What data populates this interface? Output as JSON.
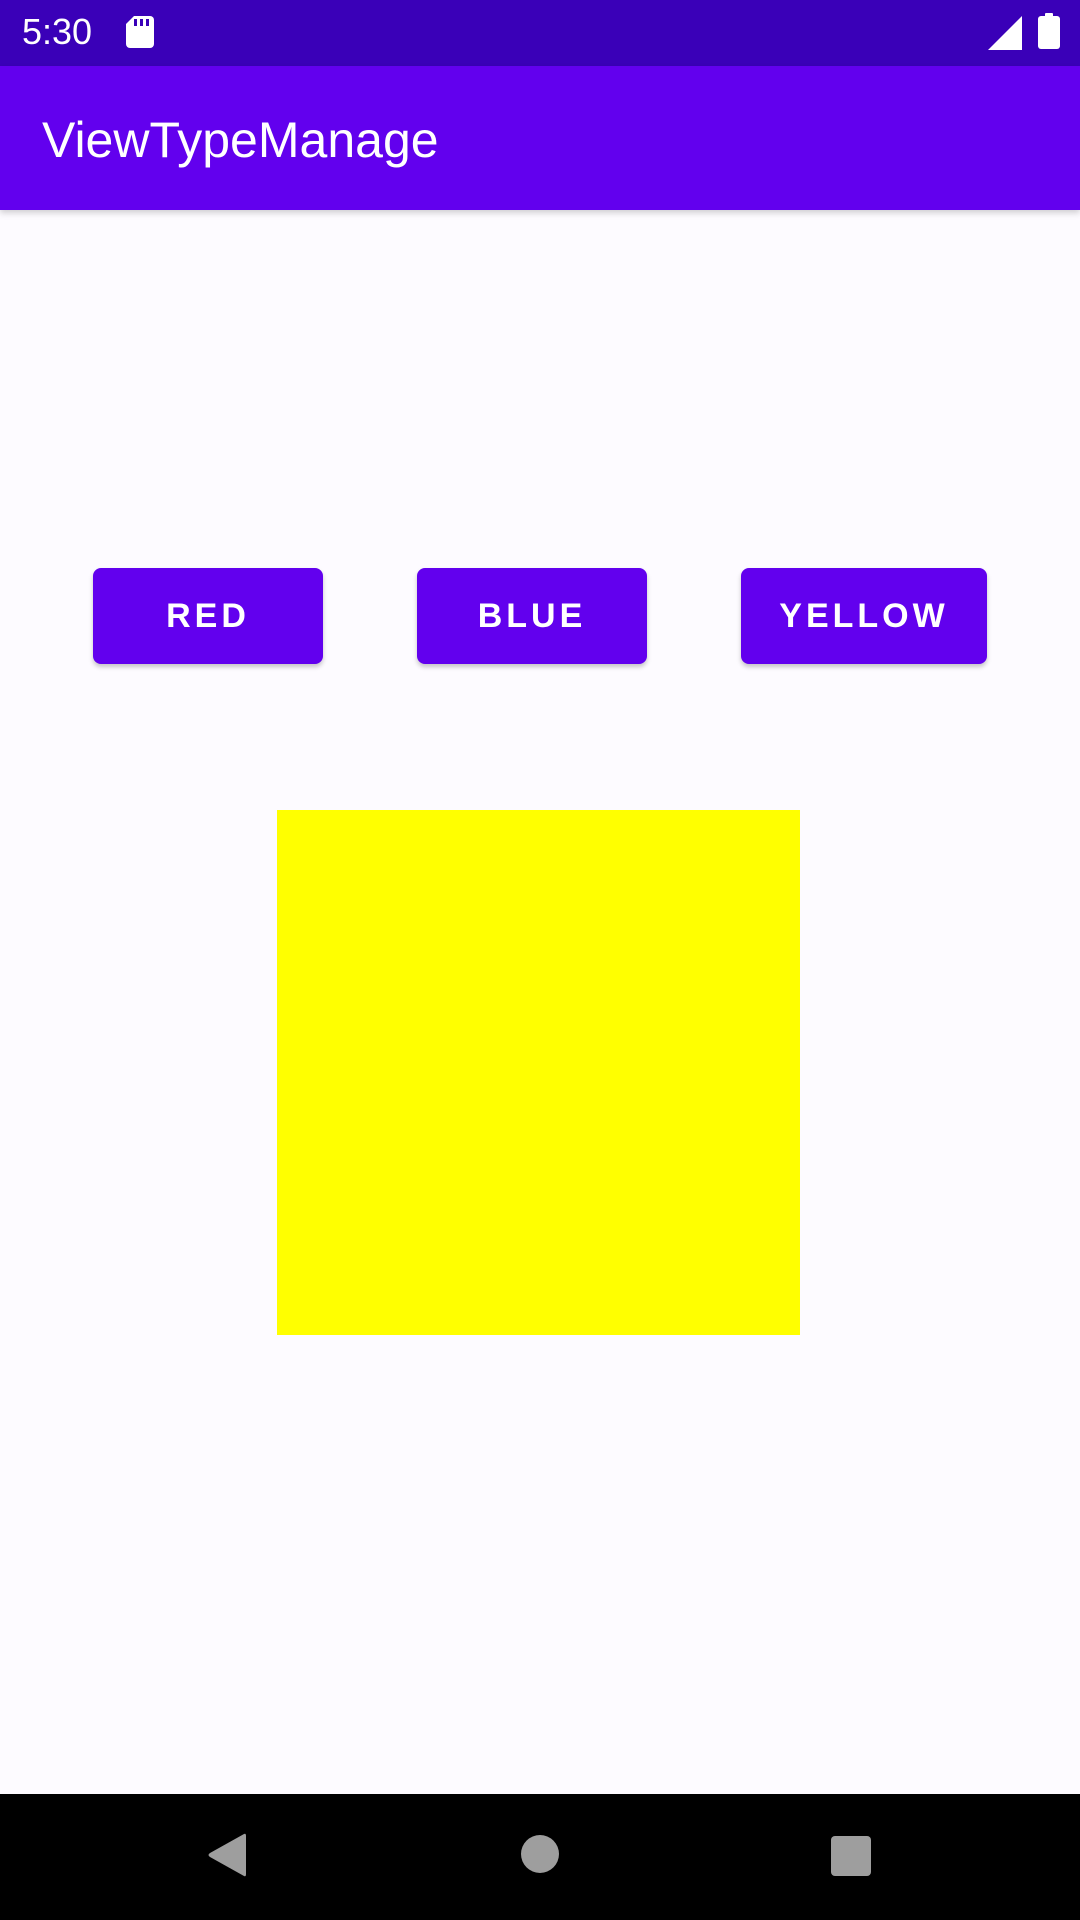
{
  "status_bar": {
    "time": "5:30",
    "icons": [
      "sd-card-icon",
      "signal-icon",
      "battery-icon"
    ]
  },
  "app_bar": {
    "title": "ViewTypeManage"
  },
  "buttons": {
    "red_label": "RED",
    "blue_label": "BLUE",
    "yellow_label": "YELLOW"
  },
  "color_box": {
    "color": "#FFFF00"
  },
  "nav_bar": {
    "icons": [
      "back-icon",
      "home-icon",
      "recents-icon"
    ]
  },
  "colors": {
    "status_bar": "#3A00B8",
    "primary": "#6200EE",
    "background": "#FDFBFF",
    "nav_bar": "#000000",
    "nav_icon": "#9E9E9E"
  }
}
